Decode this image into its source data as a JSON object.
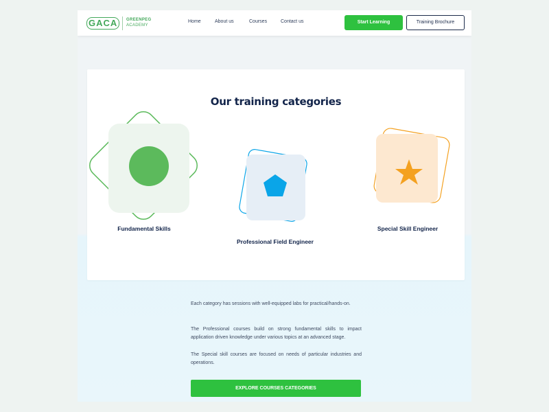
{
  "header": {
    "logo_mark": "GACA",
    "logo_line1": "GREENPEG",
    "logo_line2": "ACADEMY",
    "nav": [
      "Home",
      "About us",
      "Courses",
      "Contact us"
    ],
    "start_label": "Start Learning",
    "brochure_label": "Training Brochure"
  },
  "categories_section": {
    "title": "Our training categories",
    "items": [
      {
        "label": "Fundamental Skills",
        "icon": "circle-icon",
        "color": "#5cba5c",
        "tile": "#edf5ee"
      },
      {
        "label": "Professional Field Engineer",
        "icon": "pentagon-icon",
        "color": "#0aa5e8",
        "tile": "#e6eef6"
      },
      {
        "label": "Special Skill Engineer",
        "icon": "star-icon",
        "color": "#f4a120",
        "tile": "#fde8d0"
      }
    ]
  },
  "description": {
    "para1": "Each category has sessions with well-equipped labs for practical/hands-on.",
    "para2": "The Professional courses build on strong fundamental skills to impact application driven knowledge under various topics at an advanced stage.",
    "para3": "The Special skill courses are focused on needs of particular industries and operations."
  },
  "explore_label": "EXPLORE COURSES CATEGORIES",
  "colors": {
    "accent_green": "#2ec13f",
    "navy": "#12244a"
  }
}
